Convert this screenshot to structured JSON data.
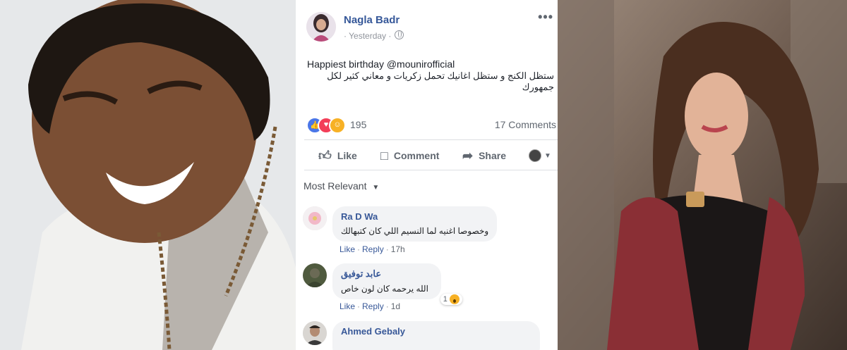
{
  "post": {
    "author": "Nagla Badr",
    "time": "· Yesterday ·",
    "text_line1": "Happiest birthday @mounirofficial",
    "text_line2": "ستظل الكنج و ستظل اغانيك تحمل زكريات و معاني كثير لكل جمهورك",
    "more_icon": "•••",
    "reaction_count": "195",
    "comment_count": "17 Comments"
  },
  "actions": {
    "like": "Like",
    "comment": "Comment",
    "share": "Share"
  },
  "sort_label": "Most Relevant",
  "comments": [
    {
      "name": "Ra D Wa",
      "text": "وخصوصا اغنيه لما النسيم اللي كان كتبهالك",
      "like": "Like",
      "reply": "Reply",
      "time": "17h"
    },
    {
      "name": "عابد توفيق",
      "text": "الله يرحمه كان لون خاص",
      "like": "Like",
      "reply": "Reply",
      "time": "1d",
      "reaction_count": "1"
    },
    {
      "name": "Ahmed Gebaly"
    }
  ],
  "colors": {
    "link_blue": "#365899",
    "like_blue": "#4a76e8",
    "love_red": "#f33e58",
    "haha_yellow": "#f7b125"
  }
}
